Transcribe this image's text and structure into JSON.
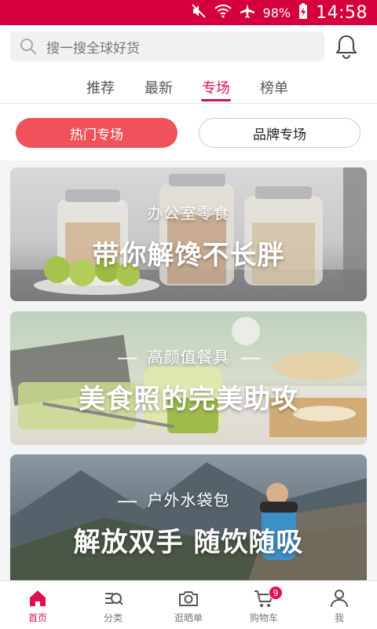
{
  "status_bar": {
    "battery": "98%",
    "time": "14:58",
    "icons": [
      "mute-icon",
      "wifi-icon",
      "airplane-icon",
      "battery-charging-icon"
    ]
  },
  "search": {
    "placeholder": "搜一搜全球好货"
  },
  "tabs": [
    {
      "label": "推荐"
    },
    {
      "label": "最新"
    },
    {
      "label": "专场",
      "active": true
    },
    {
      "label": "榜单"
    }
  ],
  "segments": {
    "hot": "热门专场",
    "brand": "品牌专场",
    "selected": "hot"
  },
  "banners": [
    {
      "subtitle": "办公室零食",
      "title": "带你解馋不长胖"
    },
    {
      "subtitle": "高颜值餐具",
      "title": "美食照的完美助攻"
    },
    {
      "subtitle": "户外水袋包",
      "title": "解放双手 随饮随吸"
    }
  ],
  "bottom_nav": [
    {
      "label": "首页",
      "icon": "home-icon",
      "active": true
    },
    {
      "label": "分类",
      "icon": "category-icon"
    },
    {
      "label": "逛晒单",
      "icon": "camera-icon"
    },
    {
      "label": "购物车",
      "icon": "cart-icon",
      "badge": "9"
    },
    {
      "label": "我",
      "icon": "person-icon"
    }
  ],
  "colors": {
    "status_bar": "#d4003e",
    "accent": "#e0104a",
    "hot_button": "#f0525b"
  }
}
